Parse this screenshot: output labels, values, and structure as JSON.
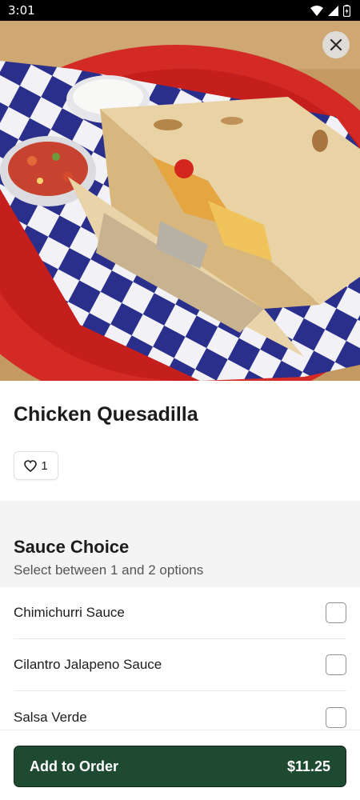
{
  "status_bar": {
    "time": "3:01",
    "icons": [
      "wifi-icon",
      "signal-icon",
      "battery-icon"
    ]
  },
  "hero": {
    "image": "chicken-quesadilla-photo",
    "close_icon": "close-icon"
  },
  "item": {
    "name": "Chicken Quesadilla",
    "likes": "1",
    "like_icon": "heart-icon"
  },
  "option_group": {
    "title": "Sauce Choice",
    "subtitle": "Select between 1 and 2 options",
    "options": [
      {
        "label": "Chimichurri Sauce",
        "checked": false
      },
      {
        "label": "Cilantro Jalapeno Sauce",
        "checked": false
      },
      {
        "label": "Salsa Verde",
        "checked": false
      }
    ]
  },
  "order_button": {
    "label": "Add to Order",
    "price": "$11.25"
  },
  "colors": {
    "accent": "#1f4a32",
    "group_bg": "#f4f4f5"
  }
}
